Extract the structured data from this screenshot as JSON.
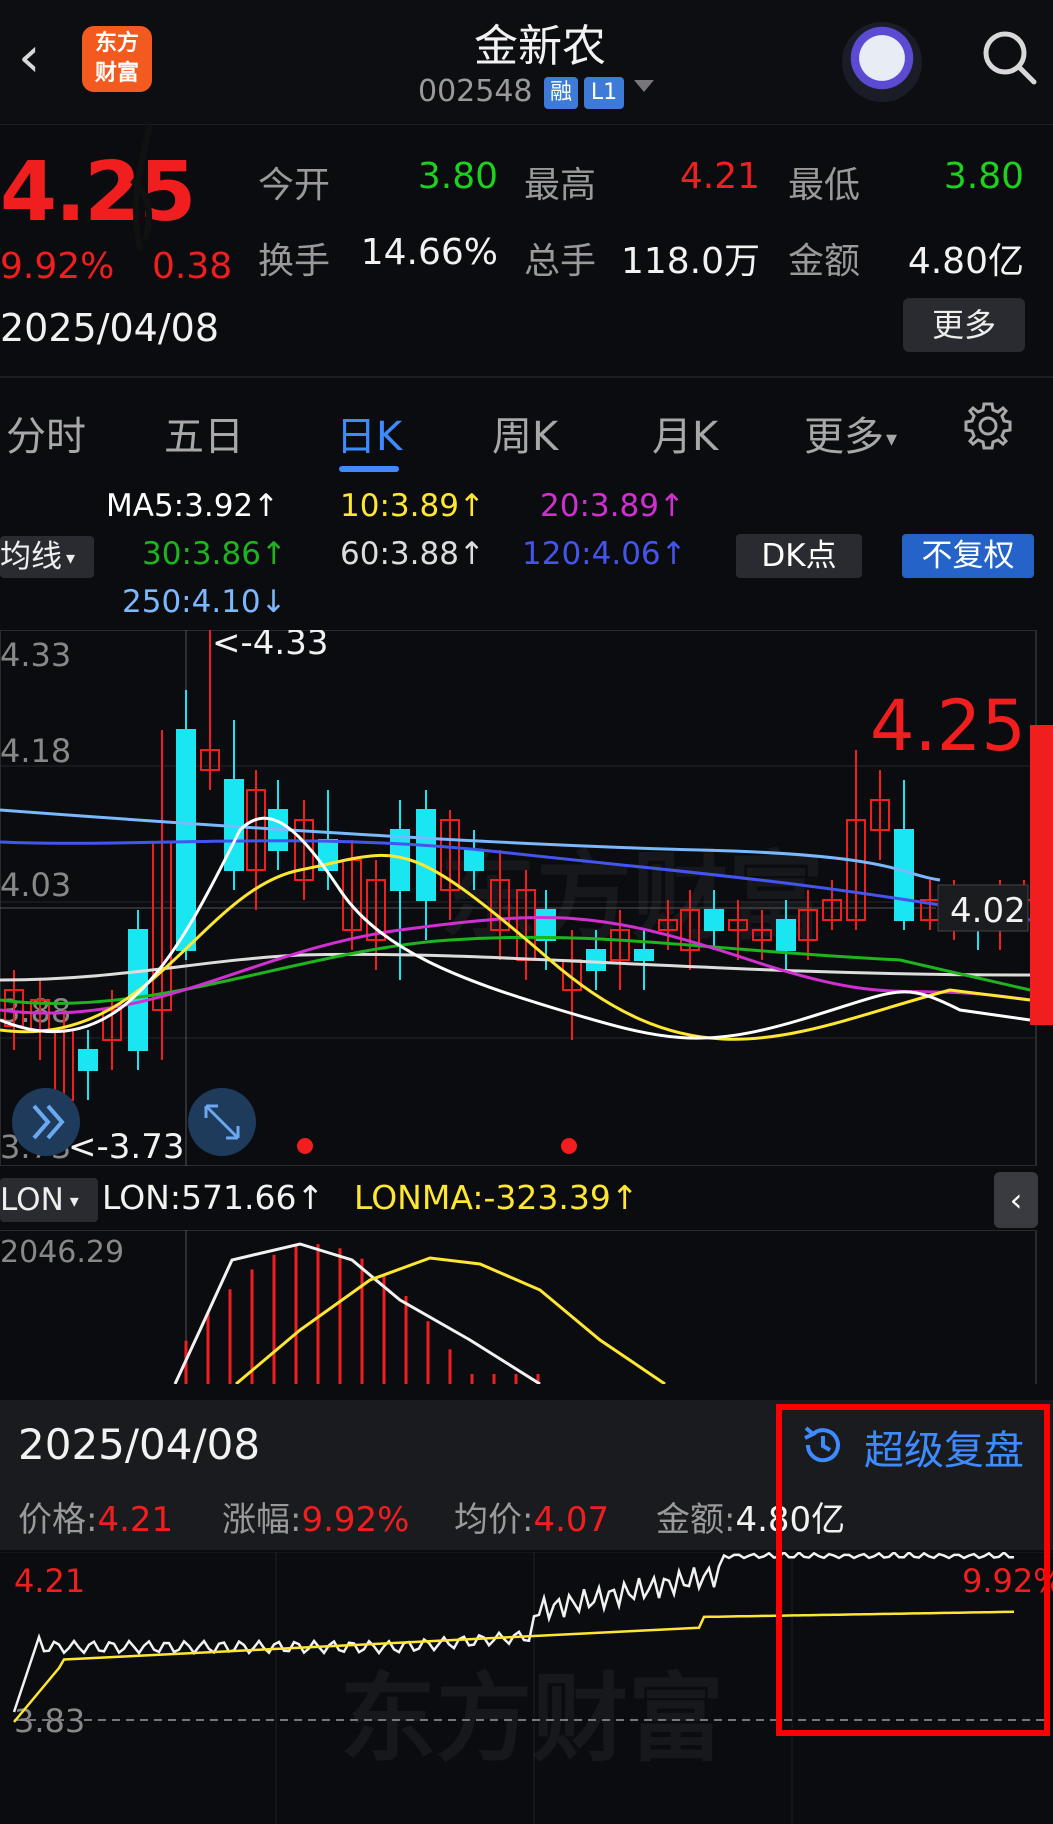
{
  "header": {
    "back_glyph": "‹",
    "logo_line1": "东方",
    "logo_line2": "财富",
    "stock_name": "金新农",
    "stock_code": "002548",
    "badge_margin": "融",
    "badge_level": "L1"
  },
  "quote": {
    "price": "4.25",
    "change_pct": "9.92%",
    "change_amt": "0.38",
    "date": "2025/04/08",
    "open_label": "今开",
    "open": "3.80",
    "high_label": "最高",
    "high": "4.21",
    "low_label": "最低",
    "low": "3.80",
    "turnover_label": "换手",
    "turnover": "14.66%",
    "volume_label": "总手",
    "volume": "118.0万",
    "amount_label": "金额",
    "amount": "4.80亿",
    "more_label": "更多"
  },
  "tabs": [
    "分时",
    "五日",
    "日K",
    "周K",
    "月K",
    "更多"
  ],
  "ma_legend": {
    "selector": "均线",
    "ma5": "MA5:3.92↑",
    "ma10": "10:3.89↑",
    "ma20": "20:3.89↑",
    "ma30": "30:3.86↑",
    "ma60": "60:3.88↑",
    "ma120": "120:4.06↑",
    "ma250": "250:4.10↓",
    "dk_label": "DK点",
    "adjust_label": "不复权"
  },
  "kline": {
    "y_labels": [
      "4.33",
      "4.18",
      "4.03",
      "3.88",
      "3.73"
    ],
    "max_marker": "<-4.33",
    "min_marker": "<-3.73",
    "last_price": "4.25",
    "crosshair_price": "4.02",
    "watermark": "东方财富"
  },
  "lon": {
    "selector": "LON",
    "lon_value": "LON:571.66↑",
    "lonma_value": "LONMA:-323.39↑",
    "top_label": "2046.29",
    "collapse_glyph": "‹"
  },
  "review": {
    "date": "2025/04/08",
    "button": "超级复盘",
    "price_label": "价格:",
    "price": "4.21",
    "chg_label": "涨幅:",
    "chg": "9.92%",
    "avg_label": "均价:",
    "avg": "4.07",
    "amt_label": "金额:",
    "amt": "4.80亿",
    "intraday_high": "4.21",
    "intraday_low": "3.83",
    "intraday_pct": "9.92%"
  },
  "colors": {
    "up": "#f01e1e",
    "down": "#1fd11f",
    "accent": "#3d8bff",
    "ma5": "#ffffff",
    "ma10": "#ffe633",
    "ma20": "#d130d1",
    "ma30": "#1fb31f",
    "ma60": "#dddddd",
    "ma120": "#4455ee",
    "ma250": "#7ab8ff"
  }
}
